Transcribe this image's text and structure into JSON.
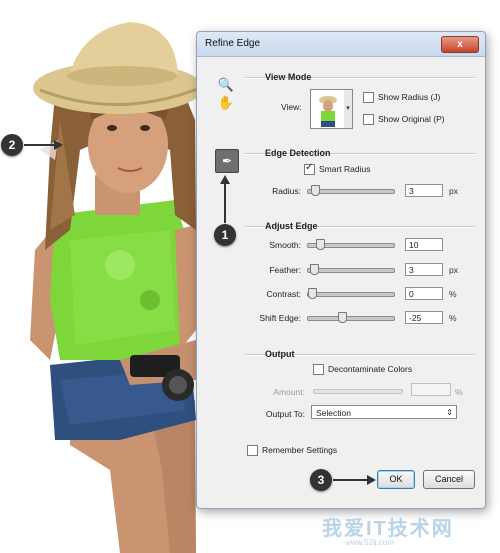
{
  "dialog": {
    "title": "Refine Edge",
    "close_label": "x"
  },
  "view_mode": {
    "heading": "View Mode",
    "view_label": "View:",
    "show_radius_label": "Show Radius (J)",
    "show_original_label": "Show Original (P)",
    "show_radius_checked": false,
    "show_original_checked": false
  },
  "edge_detection": {
    "heading": "Edge Detection",
    "smart_radius_label": "Smart Radius",
    "smart_radius_checked": true,
    "radius_label": "Radius:",
    "radius_value": "3",
    "radius_unit": "px",
    "radius_fraction": 0.04
  },
  "adjust_edge": {
    "heading": "Adjust Edge",
    "smooth_label": "Smooth:",
    "smooth_value": "10",
    "smooth_fraction": 0.1,
    "feather_label": "Feather:",
    "feather_value": "3",
    "feather_unit": "px",
    "feather_fraction": 0.03,
    "contrast_label": "Contrast:",
    "contrast_value": "0",
    "contrast_unit": "%",
    "contrast_fraction": 0,
    "shift_edge_label": "Shift Edge:",
    "shift_edge_value": "-25",
    "shift_edge_unit": "%",
    "shift_edge_fraction": 0.375
  },
  "output": {
    "heading": "Output",
    "decontaminate_label": "Decontaminate Colors",
    "decontaminate_checked": false,
    "amount_label": "Amount:",
    "amount_unit": "%",
    "output_to_label": "Output To:",
    "output_to_value": "Selection"
  },
  "remember_settings_label": "Remember Settings",
  "remember_settings_checked": false,
  "ok_label": "OK",
  "cancel_label": "Cancel",
  "callouts": [
    "1",
    "2",
    "3"
  ],
  "watermark": {
    "text": "我爱IT技术网",
    "sub": "www.52ij.com"
  },
  "colors": {
    "accent": "#3c7fb1",
    "titlebar": "#c8d8ee",
    "close": "#c8442a"
  }
}
